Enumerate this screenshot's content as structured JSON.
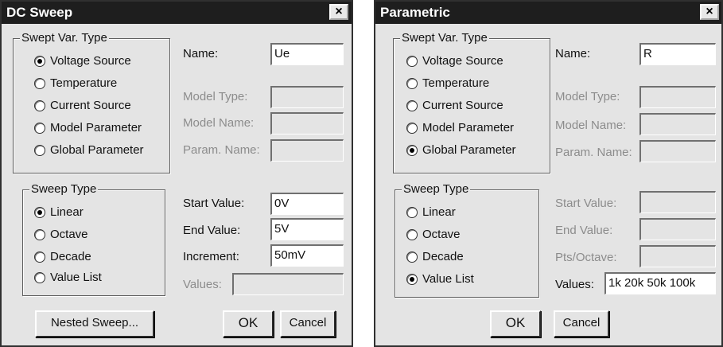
{
  "dc_sweep": {
    "title": "DC Sweep",
    "close_label": "×",
    "swept_var_type": {
      "legend": "Swept Var. Type",
      "options": [
        "Voltage Source",
        "Temperature",
        "Current Source",
        "Model Parameter",
        "Global Parameter"
      ],
      "selected": "Voltage Source"
    },
    "fields": {
      "name_label": "Name:",
      "name_value": "Ue",
      "model_type_label": "Model Type:",
      "model_name_label": "Model Name:",
      "param_name_label": "Param. Name:"
    },
    "sweep_type": {
      "legend": "Sweep Type",
      "options": [
        "Linear",
        "Octave",
        "Decade",
        "Value List"
      ],
      "selected": "Linear"
    },
    "values": {
      "start_label": "Start Value:",
      "start_value": "0V",
      "end_label": "End Value:",
      "end_value": "5V",
      "increment_label": "Increment:",
      "increment_value": "50mV",
      "values_label": "Values:"
    },
    "buttons": {
      "nested": "Nested Sweep...",
      "ok": "OK",
      "cancel": "Cancel"
    }
  },
  "parametric": {
    "title": "Parametric",
    "close_label": "×",
    "swept_var_type": {
      "legend": "Swept Var. Type",
      "options": [
        "Voltage Source",
        "Temperature",
        "Current Source",
        "Model Parameter",
        "Global Parameter"
      ],
      "selected": "Global Parameter"
    },
    "fields": {
      "name_label": "Name:",
      "name_value": "R",
      "model_type_label": "Model Type:",
      "model_name_label": "Model Name:",
      "param_name_label": "Param. Name:"
    },
    "sweep_type": {
      "legend": "Sweep Type",
      "options": [
        "Linear",
        "Octave",
        "Decade",
        "Value List"
      ],
      "selected": "Value List"
    },
    "values": {
      "start_label": "Start Value:",
      "end_label": "End Value:",
      "pts_label": "Pts/Octave:",
      "values_label": "Values:",
      "values_value": "1k 20k 50k 100k"
    },
    "buttons": {
      "ok": "OK",
      "cancel": "Cancel"
    }
  }
}
